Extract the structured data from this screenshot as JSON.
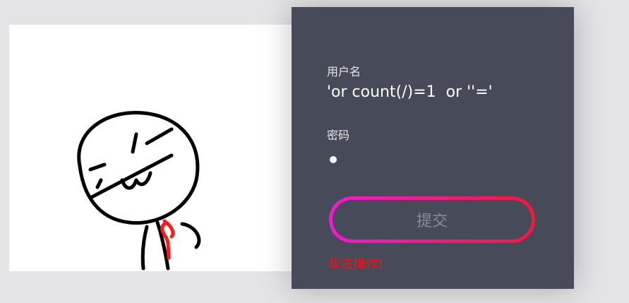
{
  "login": {
    "username_label": "用户名",
    "username_value": "'or count(/)=1  or ''='",
    "password_label": "密码",
    "password_value": "●",
    "submit_label": "提交",
    "error_message": "非法操作!"
  },
  "colors": {
    "panel_bg": "#474a59",
    "button_gradient_start": "#f01bd0",
    "button_gradient_end": "#f31a3b",
    "error": "#ff1010"
  },
  "icons": [
    "stickman-meme-image"
  ]
}
